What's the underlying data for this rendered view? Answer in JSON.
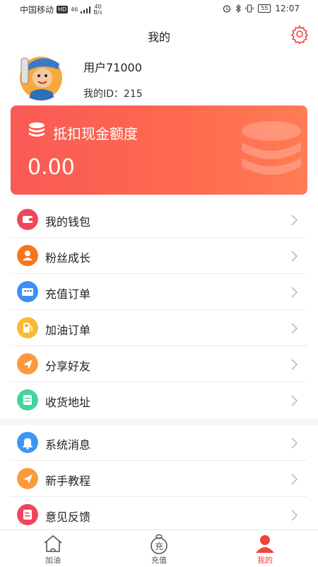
{
  "status_bar": {
    "carrier": "中国移动",
    "hd": "HD",
    "network": "46",
    "speed_value": "40",
    "speed_unit": "B/s",
    "battery": "55",
    "time": "12:07"
  },
  "header": {
    "title": "我的"
  },
  "profile": {
    "username": "用户71000",
    "user_id": "我的ID：215"
  },
  "card": {
    "title": "抵扣现金额度",
    "amount": "0.00"
  },
  "menu_group1": [
    {
      "label": "我的钱包",
      "icon": "wallet-icon",
      "color": "#f1455a"
    },
    {
      "label": "粉丝成长",
      "icon": "user-icon",
      "color": "#f8741f"
    },
    {
      "label": "充值订单",
      "icon": "card-icon",
      "color": "#3b8ff5"
    },
    {
      "label": "加油订单",
      "icon": "fuel-icon",
      "color": "#f8b934"
    },
    {
      "label": "分享好友",
      "icon": "share-icon",
      "color": "#fb9a3a"
    },
    {
      "label": "收货地址",
      "icon": "address-icon",
      "color": "#43d49a"
    }
  ],
  "menu_group2": [
    {
      "label": "系统消息",
      "icon": "bell-icon",
      "color": "#3b96f5"
    },
    {
      "label": "新手教程",
      "icon": "guide-icon",
      "color": "#fb9a3a"
    },
    {
      "label": "意见反馈",
      "icon": "feedback-icon",
      "color": "#f1455a"
    }
  ],
  "tabs": [
    {
      "label": "加油",
      "icon": "gas-station-icon"
    },
    {
      "label": "充值",
      "icon": "recharge-icon",
      "icon_text": "充"
    },
    {
      "label": "我的",
      "icon": "profile-icon"
    }
  ],
  "colors": {
    "accent": "#f04438",
    "card_start": "#f85a55",
    "card_end": "#ff7c54"
  }
}
